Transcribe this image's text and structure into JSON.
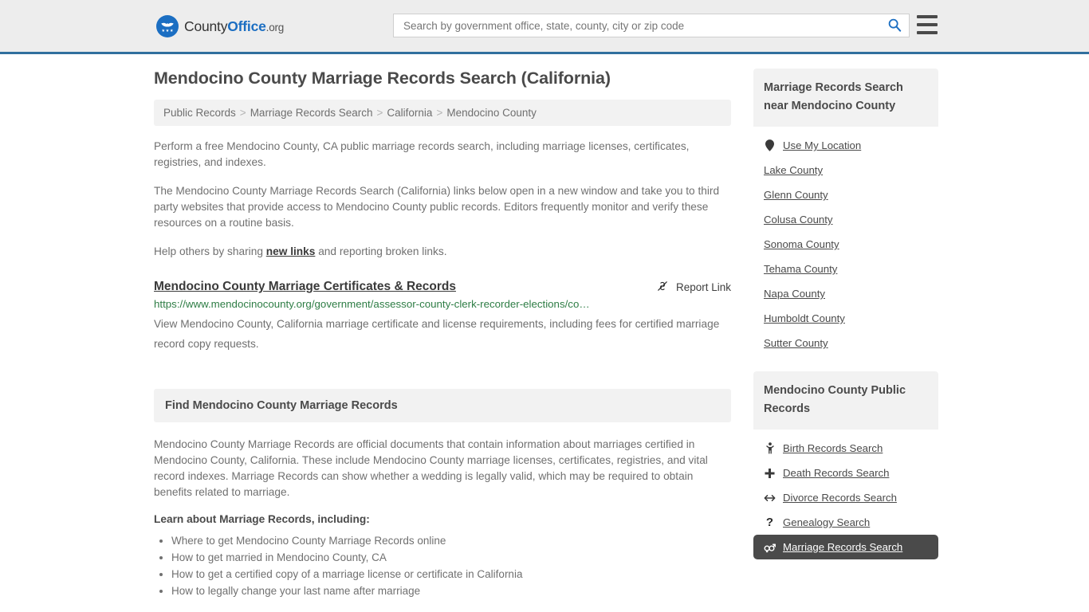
{
  "header": {
    "brand": {
      "part1": "County",
      "part2": "Office",
      "tld": ".org"
    },
    "search": {
      "placeholder": "Search by government office, state, county, city or zip code",
      "value": ""
    },
    "accent_color": "#31709e",
    "brand_color": "#1b6ec2"
  },
  "page_title": "Mendocino County Marriage Records Search (California)",
  "breadcrumb": {
    "items": [
      "Public Records",
      "Marriage Records Search",
      "California",
      "Mendocino County"
    ],
    "separator": ">"
  },
  "intro": {
    "p1": "Perform a free Mendocino County, CA public marriage records search, including marriage licenses, certificates, registries, and indexes.",
    "p2": "The Mendocino County Marriage Records Search (California) links below open in a new window and take you to third party websites that provide access to Mendocino County public records. Editors frequently monitor and verify these resources on a routine basis.",
    "p3_before": "Help others by sharing ",
    "p3_link": "new links",
    "p3_after": " and reporting broken links."
  },
  "result": {
    "title": "Mendocino County Marriage Certificates & Records",
    "report_label": "Report Link",
    "report_icon": "broken-link-icon",
    "url": "https://www.mendocinocounty.org/government/assessor-county-clerk-recorder-elections/co…",
    "description": "View Mendocino County, California marriage certificate and license requirements, including fees for certified marriage record copy requests.",
    "url_color": "#2e7d45"
  },
  "find_section": {
    "heading": "Find Mendocino County Marriage Records",
    "paragraph": "Mendocino County Marriage Records are official documents that contain information about marriages certified in Mendocino County, California. These include Mendocino County marriage licenses, certificates, registries, and vital record indexes. Marriage Records can show whether a wedding is legally valid, which may be required to obtain benefits related to marriage.",
    "learn_heading": "Learn about Marriage Records, including:",
    "bullets": [
      "Where to get Mendocino County Marriage Records online",
      "How to get married in Mendocino County, CA",
      "How to get a certified copy of a marriage license or certificate in California",
      "How to legally change your last name after marriage"
    ]
  },
  "sidebar": {
    "nearby": {
      "heading": "Marriage Records Search near Mendocino County",
      "use_my_location": {
        "label": "Use My Location",
        "icon": "map-pin-icon"
      },
      "counties": [
        "Lake County",
        "Glenn County",
        "Colusa County",
        "Sonoma County",
        "Tehama County",
        "Napa County",
        "Humboldt County",
        "Sutter County"
      ]
    },
    "public_records": {
      "heading": "Mendocino County Public Records",
      "items": [
        {
          "label": "Birth Records Search",
          "icon": "baby-icon",
          "glyph": "Ɣ",
          "active": false
        },
        {
          "label": "Death Records Search",
          "icon": "cross-icon",
          "glyph": "✚",
          "active": false
        },
        {
          "label": "Divorce Records Search",
          "icon": "left-right-arrow-icon",
          "glyph": "↔",
          "active": false
        },
        {
          "label": "Genealogy Search",
          "icon": "question-mark-icon",
          "glyph": "?",
          "active": false
        },
        {
          "label": "Marriage Records Search",
          "icon": "male-female-icon",
          "glyph": "⚥",
          "active": true
        }
      ],
      "active_bg": "#4a4a4a"
    }
  }
}
